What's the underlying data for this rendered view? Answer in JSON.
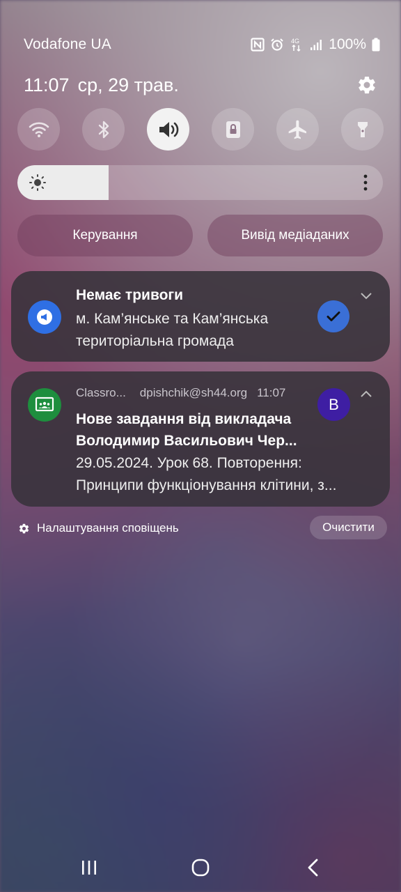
{
  "status_bar": {
    "carrier": "Vodafone UA",
    "network_label": "4G",
    "battery_percent": "100%",
    "icons": [
      "nfc-icon",
      "alarm-icon",
      "data-4g-icon",
      "signal-icon",
      "battery-icon"
    ]
  },
  "header": {
    "time": "11:07",
    "date": "ср, 29 трав."
  },
  "quick_toggles": [
    {
      "name": "wifi",
      "icon": "wifi-icon",
      "active": false
    },
    {
      "name": "bluetooth",
      "icon": "bluetooth-icon",
      "active": false
    },
    {
      "name": "sound",
      "icon": "sound-icon",
      "active": true
    },
    {
      "name": "rotation-lock",
      "icon": "lock-rotation-icon",
      "active": false
    },
    {
      "name": "airplane",
      "icon": "airplane-icon",
      "active": false
    },
    {
      "name": "flashlight",
      "icon": "flashlight-icon",
      "active": false
    }
  ],
  "brightness": {
    "level": 0.25
  },
  "media_buttons": {
    "control": "Керування",
    "media_output": "Вивід медіаданих"
  },
  "notifications": [
    {
      "app": "alert",
      "title": "Немає тривоги",
      "line1": "м. Кам’янське та Кам’янська",
      "line2": "територіальна громада"
    },
    {
      "app": "Classro...",
      "account": "dpishchik@sh44.org",
      "time": "11:07",
      "avatar_letter": "B",
      "title_line1": "Нове завдання від викладача",
      "title_line2": "Володимир Васильович Чер...",
      "body_line1": "29.05.2024. Урок 68. Повторення:",
      "body_line2": "Принципи функціонування клітини, з..."
    }
  ],
  "footer": {
    "settings_label": "Налаштування сповіщень",
    "clear_label": "Очистити"
  },
  "colors": {
    "active_toggle": "#f2f2f2",
    "alert_icon_bg": "#2f6fe4",
    "check_bg": "#3a6fd6",
    "classroom_icon_bg": "#1e8e3e",
    "avatar_bg": "#3e1ea3"
  }
}
